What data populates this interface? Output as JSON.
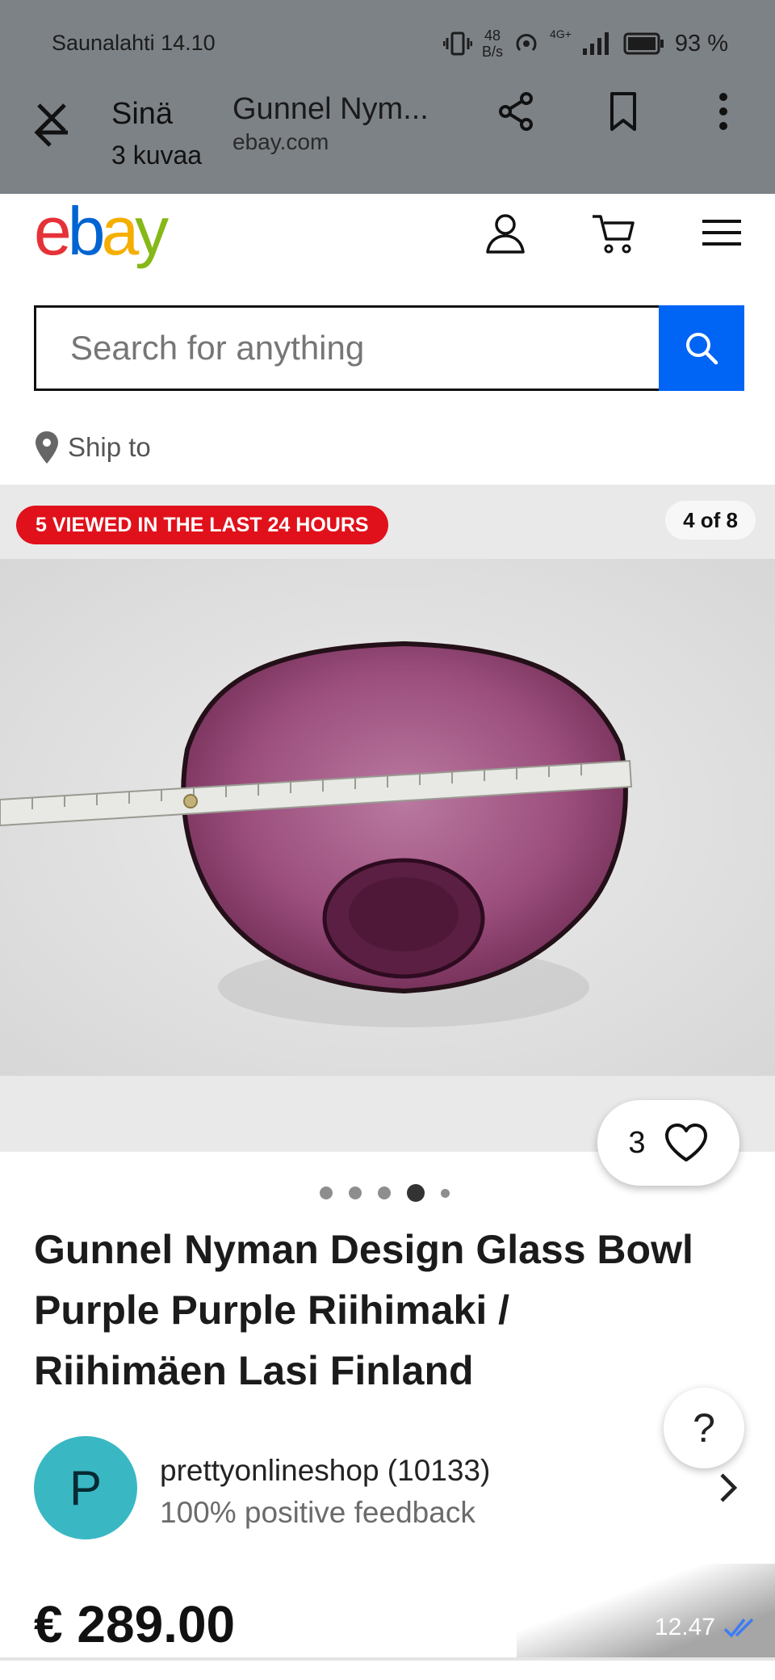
{
  "status_bar": {
    "carrier_time": "Saunalahti 14.10",
    "net_speed_value": "48",
    "net_speed_unit": "B/s",
    "signal_label": "4G+",
    "battery": "93 %"
  },
  "viewer": {
    "sender": "Sinä",
    "photo_count": "3 kuvaa",
    "page_title": "Gunnel Nym...",
    "domain": "ebay.com"
  },
  "ebay": {
    "logo": {
      "e": "e",
      "b": "b",
      "a": "a",
      "y": "y"
    },
    "search_placeholder": "Search for anything",
    "ship_to": "Ship to"
  },
  "gallery": {
    "viewed_badge": "5 VIEWED IN THE LAST 24 HOURS",
    "image_counter": "4 of 8",
    "watch_count": "3",
    "dots_total": 5,
    "dots_active_index": 3
  },
  "listing": {
    "title": "Gunnel Nyman Design Glass Bowl Purple Purple Riihimaki / Riihimäen Lasi Finland",
    "seller_initial": "P",
    "seller_name": "prettyonlineshop (10133)",
    "seller_feedback": "100% positive feedback",
    "price": "€ 289.00",
    "help_label": "?"
  },
  "message": {
    "timestamp": "12.47"
  },
  "colors": {
    "overlay": "#7d8287",
    "ebay_red": "#e53238",
    "ebay_blue": "#0064d2",
    "ebay_yellow": "#f5af02",
    "ebay_green": "#86b817",
    "search_button": "#0064f5",
    "viewed_badge": "#e0111b",
    "avatar": "#39b8c4",
    "glass_purple": "#9c4f7d"
  }
}
